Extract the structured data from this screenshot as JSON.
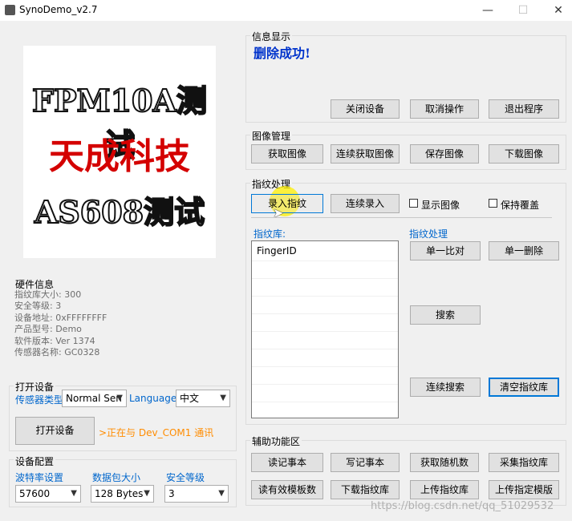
{
  "window": {
    "title": "SynoDemo_v2.7",
    "min": "—",
    "max": "☐",
    "close": "✕"
  },
  "logo": {
    "line1": "FPM10A测试",
    "line2": "天成科技",
    "line3": "AS608测试"
  },
  "hardware": {
    "label": "硬件信息",
    "lines": [
      "指纹库大小: 300",
      "安全等级: 3",
      "设备地址: 0xFFFFFFFF",
      "产品型号: Demo",
      "软件版本: Ver 1374",
      "传感器名称: GC0328"
    ]
  },
  "open_device": {
    "label": "打开设备",
    "sensor_type_label": "传感器类型",
    "sensor_type_value": "Normal Sen",
    "language_label": "Language",
    "language_value": "中文",
    "open_button": "打开设备",
    "status": ">正在与 Dev_COM1 通讯"
  },
  "device_config": {
    "label": "设备配置",
    "baud_label": "波特率设置",
    "baud_value": "57600",
    "packet_label": "数据包大小",
    "packet_value": "128 Bytes",
    "security_label": "安全等级",
    "security_value": "3"
  },
  "info_display": {
    "label": "信息显示",
    "message": "删除成功!",
    "buttons": [
      "关闭设备",
      "取消操作",
      "退出程序"
    ]
  },
  "image_manage": {
    "label": "图像管理",
    "buttons": [
      "获取图像",
      "连续获取图像",
      "保存图像",
      "下载图像"
    ]
  },
  "fingerprint": {
    "label": "指纹处理",
    "enroll": "录入指纹",
    "continuous_enroll": "连续录入",
    "show_image": "显示图像",
    "keep_cover": "保持覆盖",
    "library_label": "指纹库:",
    "process_label": "指纹处理",
    "column": "FingerID",
    "single_match": "单一比对",
    "single_delete": "单一删除",
    "search": "搜索",
    "continuous_search": "连续搜索",
    "clear_library": "清空指纹库"
  },
  "aux": {
    "label": "辅助功能区",
    "row1": [
      "读记事本",
      "写记事本",
      "获取随机数",
      "采集指纹库"
    ],
    "row2": [
      "读有效模板数",
      "下载指纹库",
      "上传指纹库",
      "上传指定模版"
    ]
  },
  "watermark": "https://blog.csdn.net/qq_51029532"
}
